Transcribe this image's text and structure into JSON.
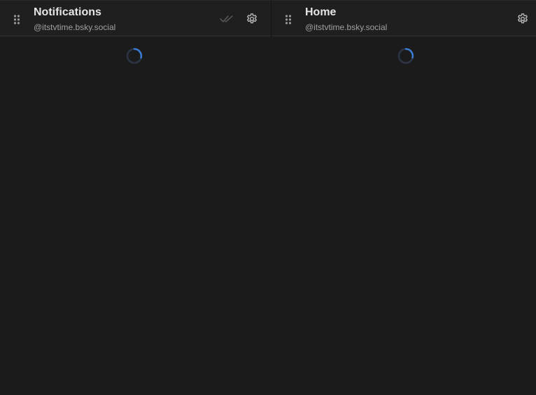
{
  "columns": [
    {
      "title": "Notifications",
      "account": "@itstvtime.bsky.social",
      "icons": [
        "drag-handle-icon",
        "double-check-icon",
        "gear-icon"
      ],
      "state": "loading"
    },
    {
      "title": "Home",
      "account": "@itstvtime.bsky.social",
      "icons": [
        "drag-handle-icon",
        "gear-icon"
      ],
      "state": "loading"
    }
  ],
  "colors": {
    "background": "#1b1b1b",
    "header_background": "#1f1f1f",
    "title_text": "#e6e6e6",
    "subtitle_text": "#a0a0a0",
    "icon": "#a8a8a8",
    "spinner_track": "#2c3546",
    "spinner_accent": "#3a7bd5"
  }
}
